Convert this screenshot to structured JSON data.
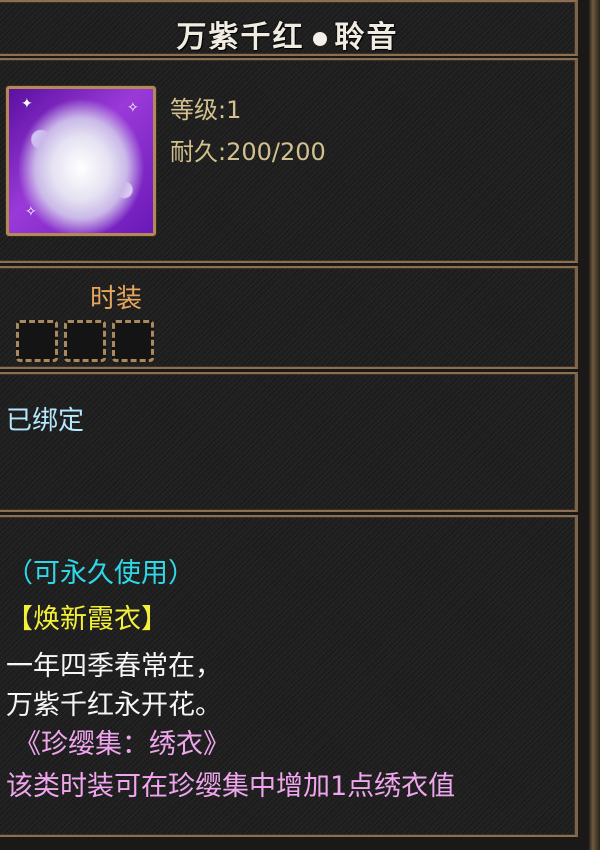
{
  "tooltip": {
    "title_left": "万紫千红",
    "title_right": "聆音",
    "stats": {
      "level_label": "等级",
      "level_value": "1",
      "durability_label": "耐久",
      "durability_value": "200/200"
    },
    "slot_section": {
      "label": "时装",
      "slot_count": 3
    },
    "bind_status": "已绑定",
    "description": [
      "（可永久使用）",
      "【焕新霞衣】",
      "一年四季春常在，",
      "万紫千红永开花。",
      "《珍缨集：绣衣》",
      "该类时装可在珍缨集中增加1点绣衣值"
    ],
    "colors": {
      "title": "#f0ece2",
      "stats": "#d2c08e",
      "slot_label": "#e6a65e",
      "bind": "#b4e8ff",
      "usage": "#2ed8e8",
      "set_name": "#f4f03a",
      "poem": "#f6f6f6",
      "collection": "#f0a6ee",
      "frame": "#8a7050"
    },
    "icon": "fashion-outfit-icon"
  }
}
